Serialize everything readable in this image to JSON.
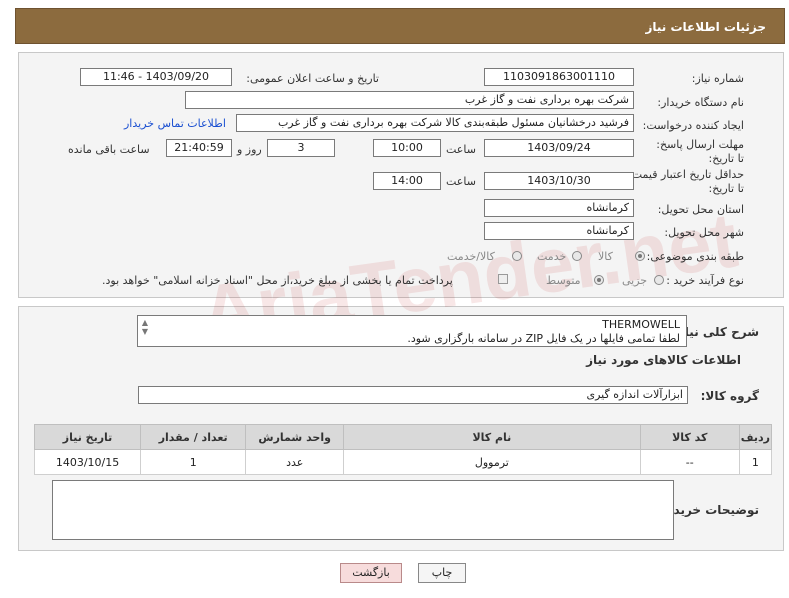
{
  "header": {
    "title": "جزئیات اطلاعات نیاز"
  },
  "form": {
    "need_number_label": "شماره نیاز:",
    "need_number": "1103091863001110",
    "announce_label": "تاریخ و ساعت اعلان عمومی:",
    "announce_value": "1403/09/20 - 11:46",
    "buyer_label": "نام دستگاه خریدار:",
    "buyer_value": "شرکت بهره برداری نفت و گاز غرب",
    "creator_label": "ایجاد کننده درخواست:",
    "creator_value": "فرشید درخشانیان مسئول طبقه‌بندی کالا شرکت بهره برداری نفت و گاز غرب",
    "contact_link": "اطلاعات تماس خریدار",
    "deadline_label": "مهلت ارسال پاسخ: تا تاریخ:",
    "deadline_date": "1403/09/24",
    "time_label": "ساعت",
    "deadline_time": "10:00",
    "days_value": "3",
    "days_label": "روز و",
    "remaining_value": "21:40:59",
    "remaining_label": "ساعت باقی مانده",
    "validity_label": "حداقل تاریخ اعتبار قیمت: تا تاریخ:",
    "validity_date": "1403/10/30",
    "validity_time_label": "ساعت",
    "validity_time": "14:00",
    "province_label": "استان محل تحویل:",
    "province_value": "کرمانشاه",
    "city_label": "شهر محل تحویل:",
    "city_value": "کرمانشاه",
    "category_label": "طبقه بندی موضوعی:",
    "category_options": [
      "کالا",
      "خدمت",
      "کالا/خدمت"
    ],
    "process_label": "نوع فرآیند خرید :",
    "process_options": [
      "جزیی",
      "متوسط"
    ],
    "payment_text": "پرداخت تمام یا بخشی از مبلغ خرید،از محل \"اسناد خزانه اسلامی\" خواهد بود."
  },
  "description": {
    "label": "شرح کلی نیاز:",
    "line1": "THERMOWELL",
    "line2": "لطفا تمامی فایلها در یک فایل ZIP  در سامانه بارگزاری شود."
  },
  "goods": {
    "section_title": "اطلاعات کالاهای مورد نیاز",
    "group_label": "گروه کالا:",
    "group_value": "ابزارآلات اندازه گیری"
  },
  "table": {
    "headers": [
      "ردیف",
      "کد کالا",
      "نام کالا",
      "واحد شمارش",
      "تعداد / مقدار",
      "تاریخ نیاز"
    ],
    "rows": [
      [
        "1",
        "--",
        "ترموول",
        "عدد",
        "1",
        "1403/10/15"
      ]
    ]
  },
  "buyer_notes": {
    "label": "توضیحات خریدار:"
  },
  "buttons": {
    "print": "چاپ",
    "back": "بازگشت"
  },
  "watermark": {
    "text": "AriaTender.net"
  }
}
